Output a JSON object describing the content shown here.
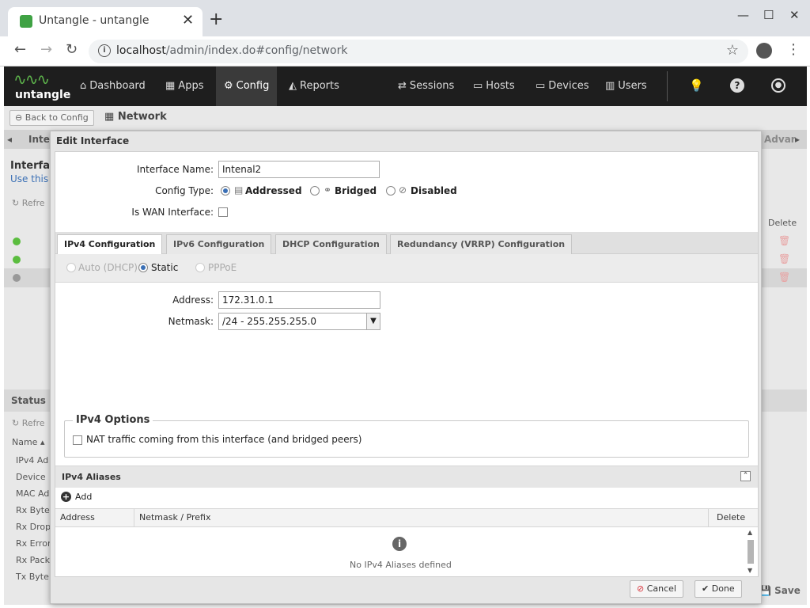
{
  "browser": {
    "tab_title": "Untangle - untangle",
    "url_host": "localhost",
    "url_path": "/admin/index.do#config/network"
  },
  "nav": {
    "logo_text": "untangle",
    "items": [
      {
        "label": "Dashboard"
      },
      {
        "label": "Apps"
      },
      {
        "label": "Config"
      },
      {
        "label": "Reports"
      },
      {
        "label": "Sessions"
      },
      {
        "label": "Hosts"
      },
      {
        "label": "Devices"
      },
      {
        "label": "Users"
      }
    ]
  },
  "background": {
    "back_label": "Back to Config",
    "crumb": "Network",
    "tab_left": "Inte",
    "tab_right": "Advar",
    "section_title": "Interfa",
    "section_desc": "Use this",
    "refresh": "Refre",
    "delete_col": "Delete",
    "status_title": "Status",
    "status_refresh": "Refre",
    "name_col": "Name",
    "rows": [
      "IPv4 Ad",
      "Device",
      "MAC Ad",
      "Rx Byte",
      "Rx Drop",
      "Rx Error",
      "Rx Pack",
      "Tx Byte"
    ],
    "save": "Save"
  },
  "modal": {
    "title": "Edit Interface",
    "interface_name_label": "Interface Name:",
    "interface_name_value": "Intenal2",
    "config_type_label": "Config Type:",
    "config_types": [
      "Addressed",
      "Bridged",
      "Disabled"
    ],
    "is_wan_label": "Is WAN Interface:",
    "tabs": [
      "IPv4 Configuration",
      "IPv6 Configuration",
      "DHCP Configuration",
      "Redundancy (VRRP) Configuration"
    ],
    "modes": [
      "Auto (DHCP)",
      "Static",
      "PPPoE"
    ],
    "address_label": "Address:",
    "address_value": "172.31.0.1",
    "netmask_label": "Netmask:",
    "netmask_value": "/24 - 255.255.255.0",
    "options_legend": "IPv4 Options",
    "nat_label": "NAT traffic coming from this interface (and bridged peers)",
    "aliases_title": "IPv4 Aliases",
    "add_label": "Add",
    "col_address": "Address",
    "col_netmask": "Netmask / Prefix",
    "col_delete": "Delete",
    "empty_text": "No IPv4 Aliases defined",
    "cancel": "Cancel",
    "done": "Done"
  }
}
